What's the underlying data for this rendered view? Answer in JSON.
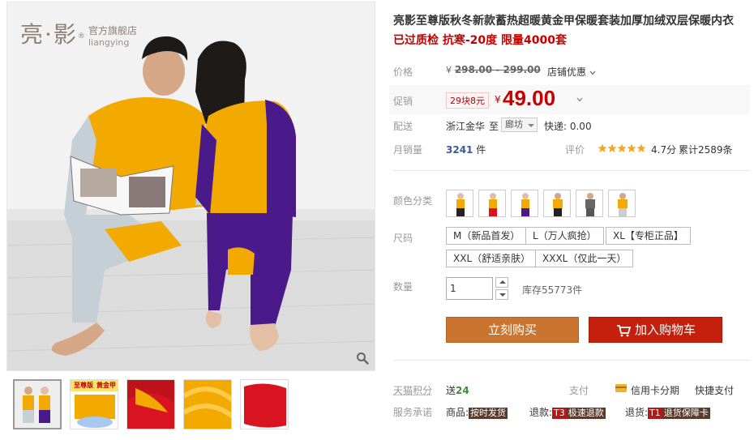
{
  "brand": {
    "name_cn": "亮·影",
    "reg": "®",
    "store": "官方旗舰店",
    "name_en": "liangying"
  },
  "gallery": {
    "thumbnails": [
      {
        "name": "thumb-couple"
      },
      {
        "name": "thumb-banner",
        "text": "至尊版",
        "text2": "黄金甲"
      },
      {
        "name": "thumb-red-fabric"
      },
      {
        "name": "thumb-yellow-fabric"
      },
      {
        "name": "thumb-red-cloth"
      }
    ]
  },
  "product": {
    "title": "亮影至尊版秋冬新款蓄热超暖黄金甲保暖套装加厚加绒双层保暖内衣",
    "subtitle": "已过质检 抗寒-20度 限量4000套"
  },
  "price": {
    "label": "价格",
    "yen": "¥",
    "original": "298.00 - 299.00",
    "store_promo": "店铺优惠"
  },
  "promo": {
    "label": "促销",
    "tag": "29块8元",
    "yen": "¥",
    "price": "49.00"
  },
  "shipping": {
    "label": "配送",
    "from": "浙江金华",
    "to_word": "至",
    "to_city": "廊坊",
    "fee": "快递: 0.00"
  },
  "sales": {
    "label": "月销量",
    "count": "3241",
    "unit": "件",
    "rating_label": "评价",
    "stars": 5,
    "score": "4.7分",
    "reviews": "累计2589条"
  },
  "colors": {
    "label": "颜色分类",
    "swatches": [
      "black-female",
      "red-female",
      "purple-female",
      "black-male",
      "grey-male",
      "yellow-male"
    ]
  },
  "sizes": {
    "label": "尺码",
    "options": [
      "M（新品首发）",
      "L（万人疯抢）",
      "XL【专柜正品】",
      "XXL（舒适亲肤）",
      "XXXL（仅此一天）"
    ]
  },
  "quantity": {
    "label": "数量",
    "value": "1",
    "stock": "库存55773件"
  },
  "actions": {
    "buy": "立刻购买",
    "cart": "加入购物车"
  },
  "points": {
    "label": "天猫积分",
    "prefix": "送",
    "value": "24",
    "pay_label": "支付",
    "credit": "信用卡分期",
    "fast": "快捷支付"
  },
  "services": {
    "label": "服务承诺",
    "goods_label": "商品:",
    "goods_badge": "按时发货",
    "refund_label": "退款:",
    "refund_code": "T3",
    "refund_badge": "极速退款",
    "return_label": "退货:",
    "return_code": "T1",
    "return_badge": "退货保障卡"
  },
  "colors_hex": {
    "accent_red": "#c40000",
    "buy_orange": "#c9742f",
    "cart_red": "#c4200d",
    "gold": "#f2a900",
    "purple": "#4a1a8a"
  }
}
